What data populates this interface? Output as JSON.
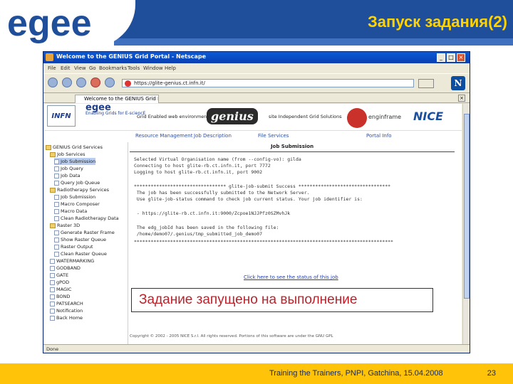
{
  "slide": {
    "title": "Запуск задания(2)",
    "footer_text": "Training the Trainers, PNPI, Gatchina, 15.04.2008",
    "page_number": "23",
    "overlay_message": "Задание запущено на выполнение"
  },
  "logo": {
    "text": "egee",
    "color": "#1f4f9b"
  },
  "browser": {
    "window_title": "Welcome to the GENIUS Grid Portal - Netscape",
    "menu": [
      "File",
      "Edit",
      "View",
      "Go",
      "Bookmarks",
      "Tools",
      "Window",
      "Help"
    ],
    "url": "https://glite-genius.ct.infn.it/",
    "tab_label": "Welcome to the GENIUS Grid Portal",
    "status_text": "Done"
  },
  "portal": {
    "banner": {
      "infn": "INFN",
      "egee_small": "Enabling Grids for E-sciencE",
      "left_text": "Grid Enabled web environment",
      "genius": "genius",
      "right_text": "site Independent Grid Solutions",
      "enginframe": "enginframe",
      "nice": "NICE"
    },
    "navlinks": [
      "Resource Management",
      "Job Description",
      "File Services",
      "Portal Info"
    ],
    "tree": [
      {
        "label": "GENIUS Grid Services",
        "indent": 0,
        "folder": true
      },
      {
        "label": "Job Services",
        "indent": 1,
        "folder": true
      },
      {
        "label": "Job Submission",
        "indent": 2,
        "folder": false,
        "selected": true
      },
      {
        "label": "Job Query",
        "indent": 2,
        "folder": false
      },
      {
        "label": "Job Data",
        "indent": 2,
        "folder": false
      },
      {
        "label": "Query Job Queue",
        "indent": 2,
        "folder": false
      },
      {
        "label": "Radiotherapy Services",
        "indent": 1,
        "folder": true
      },
      {
        "label": "Job Submission",
        "indent": 2,
        "folder": false
      },
      {
        "label": "Macro Composer",
        "indent": 2,
        "folder": false
      },
      {
        "label": "Macro Data",
        "indent": 2,
        "folder": false
      },
      {
        "label": "Clean Radiotherapy Data",
        "indent": 2,
        "folder": false
      },
      {
        "label": "Raster 3D",
        "indent": 1,
        "folder": true
      },
      {
        "label": "Generate Raster Frame",
        "indent": 2,
        "folder": false
      },
      {
        "label": "Show Raster Queue",
        "indent": 2,
        "folder": false
      },
      {
        "label": "Raster Output",
        "indent": 2,
        "folder": false
      },
      {
        "label": "Clean Raster Queue",
        "indent": 2,
        "folder": false
      },
      {
        "label": "WATERMARKING",
        "indent": 1,
        "folder": false
      },
      {
        "label": "GODBAND",
        "indent": 1,
        "folder": false
      },
      {
        "label": "GATE",
        "indent": 1,
        "folder": false
      },
      {
        "label": "gPOD",
        "indent": 1,
        "folder": false
      },
      {
        "label": "MAGIC",
        "indent": 1,
        "folder": false
      },
      {
        "label": "BOND",
        "indent": 1,
        "folder": false
      },
      {
        "label": "PATSEARCH",
        "indent": 1,
        "folder": false
      },
      {
        "label": "Notification",
        "indent": 1,
        "folder": false
      },
      {
        "label": "Back Home",
        "indent": 1,
        "folder": false
      }
    ],
    "content": {
      "header": "Job Submission",
      "log": [
        "Selected Virtual Organisation name (from --config-vo): gilda",
        "Connecting to host glite-rb.ct.infn.it, port 7772",
        "Logging to host glite-rb.ct.infn.it, port 9002",
        "",
        "********************************* glite-job-submit Success *********************************",
        " The job has been successfully submitted to the Network Server.",
        " Use glite-job-status command to check job current status. Your job identifier is:",
        "",
        " - https://glite-rb.ct.infn.it:9000/Zcpoe1NJJPfz0SZMvhJk",
        "",
        " The edg_jobId has been saved in the following file:",
        " /home/demo07/.genius/tmp_submitted_job_demo07",
        "*********************************************************************************************"
      ],
      "status_link": "Click here to see the status of this job"
    },
    "copyright": "Copyright © 2002 - 2005 NICE S.r.l. All rights reserved. Portions of this software are under the GNU GPL"
  }
}
